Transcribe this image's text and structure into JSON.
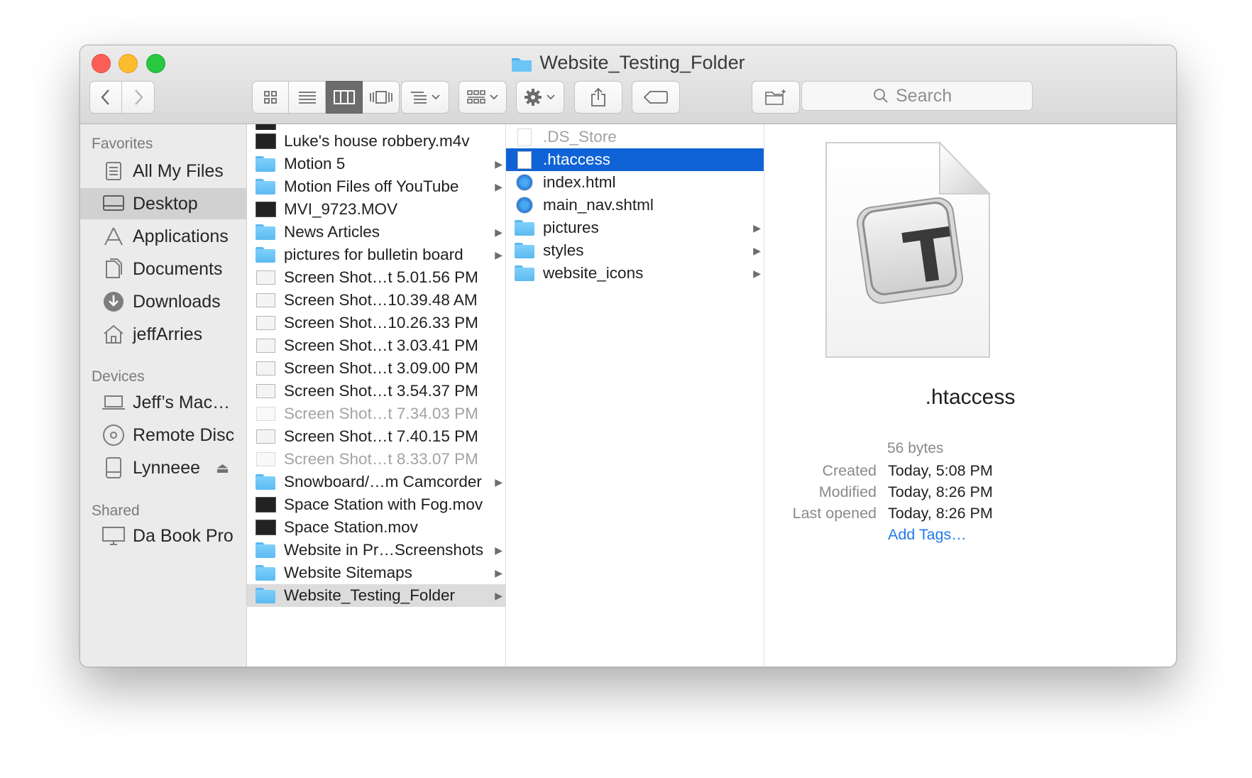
{
  "window": {
    "title": "Website_Testing_Folder"
  },
  "toolbar": {
    "search_placeholder": "Search",
    "view_modes": [
      "icon-view",
      "list-view",
      "column-view",
      "cover-flow-view"
    ],
    "active_view": "column-view"
  },
  "sidebar": {
    "favorites_label": "Favorites",
    "favorites": [
      {
        "label": "All My Files",
        "icon": "all-files-icon"
      },
      {
        "label": "Desktop",
        "icon": "desktop-icon",
        "selected": true
      },
      {
        "label": "Applications",
        "icon": "applications-icon"
      },
      {
        "label": "Documents",
        "icon": "documents-icon"
      },
      {
        "label": "Downloads",
        "icon": "downloads-icon"
      },
      {
        "label": "jeffArries",
        "icon": "home-icon"
      }
    ],
    "devices_label": "Devices",
    "devices": [
      {
        "label": "Jeff’s Mac…",
        "icon": "laptop-icon"
      },
      {
        "label": "Remote Disc",
        "icon": "disc-icon"
      },
      {
        "label": "Lynneee",
        "icon": "drive-icon",
        "eject": true
      }
    ],
    "shared_label": "Shared",
    "shared": [
      {
        "label": "Da Book Pro",
        "icon": "display-icon"
      }
    ]
  },
  "column1": {
    "items": [
      {
        "label": "Luke's house robbery.m4v",
        "kind": "video"
      },
      {
        "label": "Motion 5",
        "kind": "folder",
        "arrow": true
      },
      {
        "label": "Motion Files off YouTube",
        "kind": "folder",
        "arrow": true
      },
      {
        "label": "MVI_9723.MOV",
        "kind": "video"
      },
      {
        "label": "News Articles",
        "kind": "folder",
        "arrow": true
      },
      {
        "label": "pictures for bulletin board",
        "kind": "folder",
        "arrow": true
      },
      {
        "label": "Screen Shot…t 5.01.56 PM",
        "kind": "screenshot"
      },
      {
        "label": "Screen Shot…10.39.48 AM",
        "kind": "screenshot"
      },
      {
        "label": "Screen Shot…10.26.33 PM",
        "kind": "screenshot"
      },
      {
        "label": "Screen Shot…t 3.03.41 PM",
        "kind": "screenshot"
      },
      {
        "label": "Screen Shot…t 3.09.00 PM",
        "kind": "screenshot"
      },
      {
        "label": "Screen Shot…t 3.54.37 PM",
        "kind": "screenshot"
      },
      {
        "label": "Screen Shot…t 7.34.03 PM",
        "kind": "screenshot",
        "dim": true
      },
      {
        "label": "Screen Shot…t 7.40.15 PM",
        "kind": "screenshot"
      },
      {
        "label": "Screen Shot…t 8.33.07 PM",
        "kind": "screenshot",
        "dim": true
      },
      {
        "label": "Snowboard/…m Camcorder",
        "kind": "folder",
        "arrow": true
      },
      {
        "label": "Space Station with Fog.mov",
        "kind": "video"
      },
      {
        "label": "Space Station.mov",
        "kind": "video"
      },
      {
        "label": "Website in Pr…Screenshots",
        "kind": "folder",
        "arrow": true
      },
      {
        "label": "Website Sitemaps",
        "kind": "folder",
        "arrow": true
      },
      {
        "label": "Website_Testing_Folder",
        "kind": "folder",
        "arrow": true,
        "selected": true
      }
    ]
  },
  "column2": {
    "items": [
      {
        "label": ".DS_Store",
        "kind": "doc",
        "dim": true
      },
      {
        "label": ".htaccess",
        "kind": "doc",
        "selected": true
      },
      {
        "label": "index.html",
        "kind": "html"
      },
      {
        "label": "main_nav.shtml",
        "kind": "html"
      },
      {
        "label": "pictures",
        "kind": "folder",
        "arrow": true
      },
      {
        "label": "styles",
        "kind": "folder",
        "arrow": true
      },
      {
        "label": "website_icons",
        "kind": "folder",
        "arrow": true
      }
    ]
  },
  "preview": {
    "icon_letter": "T",
    "name": ".htaccess",
    "size": "56 bytes",
    "meta": [
      {
        "key": "Created",
        "value": "Today, 5:08 PM"
      },
      {
        "key": "Modified",
        "value": "Today, 8:26 PM"
      },
      {
        "key": "Last opened",
        "value": "Today, 8:26 PM"
      }
    ],
    "add_tags": "Add Tags…"
  },
  "colors": {
    "selection": "#0f63d6",
    "folder": "#6cc4f7",
    "link": "#1e7ae8"
  }
}
